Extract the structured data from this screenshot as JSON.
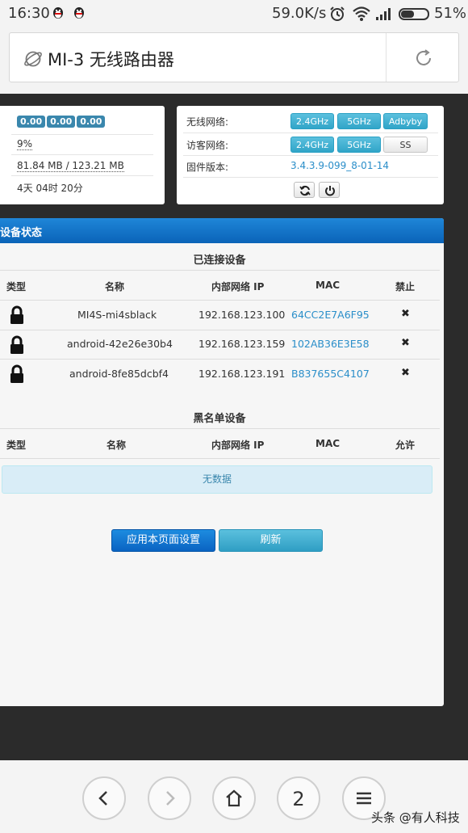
{
  "status_bar": {
    "time": "16:30",
    "net_speed": "59.0K/s",
    "battery": "51%"
  },
  "browser": {
    "url_title": "MI-3 无线路由器"
  },
  "system_panel": {
    "load_badges": [
      "0.00",
      "0.00",
      "0.00"
    ],
    "cpu": "9%",
    "memory": "81.84 MB / 123.21 MB",
    "uptime": "4天 04时 20分"
  },
  "network_panel": {
    "wireless_label": "无线网络:",
    "guest_label": "访客网络:",
    "firmware_label": "固件版本:",
    "wireless_buttons": [
      "2.4GHz",
      "5GHz",
      "Adbyby"
    ],
    "guest_buttons": [
      "2.4GHz",
      "5GHz",
      "SS"
    ],
    "firmware_version": "3.4.3.9-099_8-01-14"
  },
  "device_status": {
    "header": "设备状态",
    "connected_title": "已连接设备",
    "connected_columns": [
      "类型",
      "名称",
      "内部网络 IP",
      "MAC",
      "禁止"
    ],
    "connected_rows": [
      {
        "name": "MI4S-mi4sblack",
        "ip": "192.168.123.100",
        "mac": "64CC2E7A6F95"
      },
      {
        "name": "android-42e26e30b4",
        "ip": "192.168.123.159",
        "mac": "102AB36E3E58"
      },
      {
        "name": "android-8fe85dcbf4",
        "ip": "192.168.123.191",
        "mac": "B837655C4107"
      }
    ],
    "blacklist_title": "黑名单设备",
    "blacklist_columns": [
      "类型",
      "名称",
      "内部网络 IP",
      "MAC",
      "允许"
    ],
    "no_data": "无数据",
    "apply_button": "应用本页面设置",
    "refresh_button": "刷新"
  },
  "bottom_nav": {
    "tab_count": "2",
    "watermark": "头条 @有人科技"
  },
  "colors": {
    "header_blue": "#0a63b8",
    "info_blue": "#5bc0de",
    "link_blue": "#2a8ec9"
  }
}
